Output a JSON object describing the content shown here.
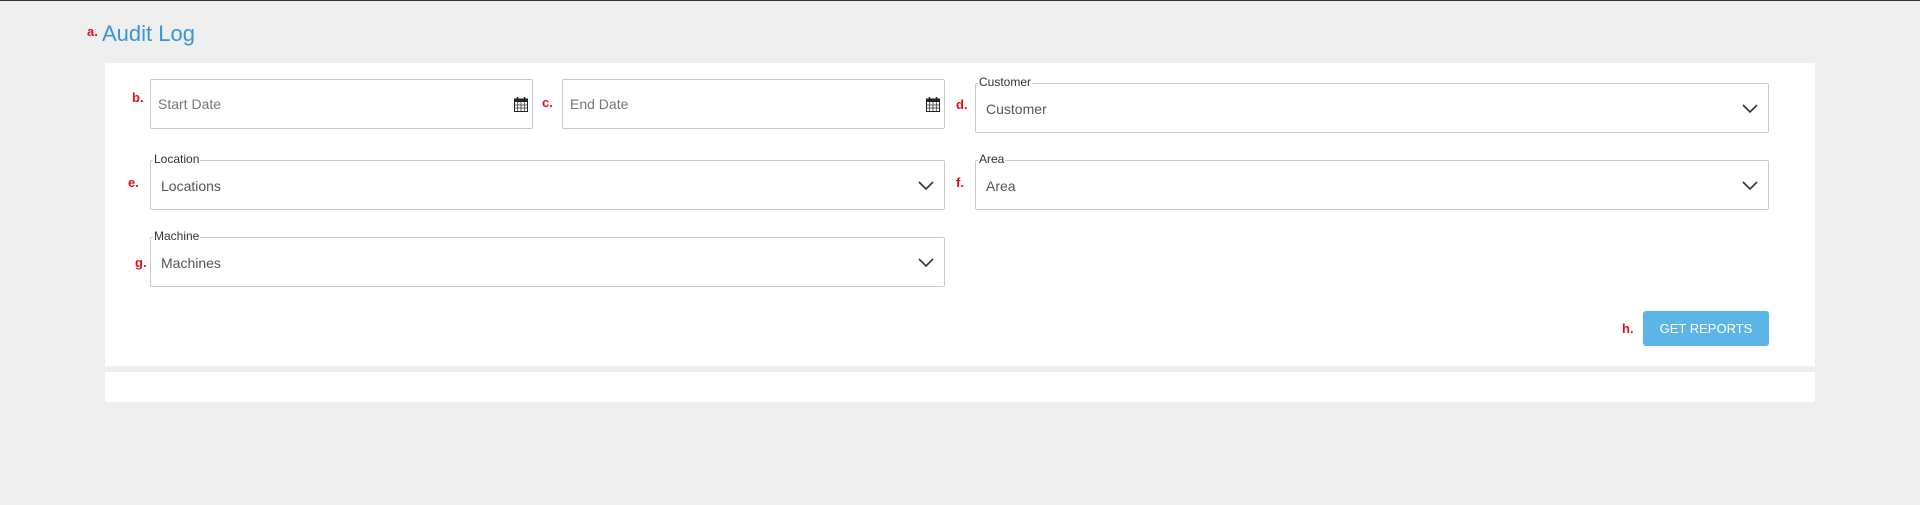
{
  "page": {
    "title": "Audit Log"
  },
  "markers": {
    "a": "a.",
    "b": "b.",
    "c": "c.",
    "d": "d.",
    "e": "e.",
    "f": "f.",
    "g": "g.",
    "h": "h."
  },
  "filters": {
    "start_date": {
      "placeholder": "Start Date",
      "icon": "calendar-icon"
    },
    "end_date": {
      "placeholder": "End Date",
      "icon": "calendar-icon"
    },
    "customer": {
      "legend": "Customer",
      "value": "Customer"
    },
    "location": {
      "legend": "Location",
      "value": "Locations"
    },
    "area": {
      "legend": "Area",
      "value": "Area"
    },
    "machine": {
      "legend": "Machine",
      "value": "Machines"
    }
  },
  "actions": {
    "get_reports_label": "GET REPORTS"
  },
  "colors": {
    "title": "#3a95d8",
    "button": "#5bb5e6",
    "marker": "#e0101a",
    "background": "#efefef"
  }
}
